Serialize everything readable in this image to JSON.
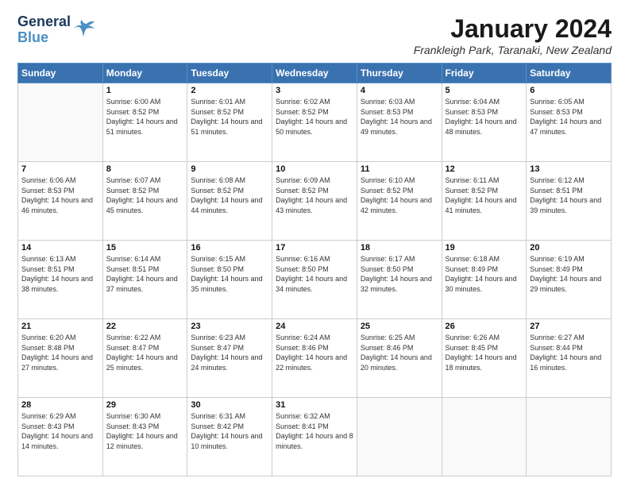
{
  "logo": {
    "line1": "General",
    "line2": "Blue"
  },
  "header": {
    "title": "January 2024",
    "location": "Frankleigh Park, Taranaki, New Zealand"
  },
  "days_of_week": [
    "Sunday",
    "Monday",
    "Tuesday",
    "Wednesday",
    "Thursday",
    "Friday",
    "Saturday"
  ],
  "weeks": [
    [
      {
        "day": "",
        "sunrise": "",
        "sunset": "",
        "daylight": ""
      },
      {
        "day": "1",
        "sunrise": "Sunrise: 6:00 AM",
        "sunset": "Sunset: 8:52 PM",
        "daylight": "Daylight: 14 hours and 51 minutes."
      },
      {
        "day": "2",
        "sunrise": "Sunrise: 6:01 AM",
        "sunset": "Sunset: 8:52 PM",
        "daylight": "Daylight: 14 hours and 51 minutes."
      },
      {
        "day": "3",
        "sunrise": "Sunrise: 6:02 AM",
        "sunset": "Sunset: 8:52 PM",
        "daylight": "Daylight: 14 hours and 50 minutes."
      },
      {
        "day": "4",
        "sunrise": "Sunrise: 6:03 AM",
        "sunset": "Sunset: 8:53 PM",
        "daylight": "Daylight: 14 hours and 49 minutes."
      },
      {
        "day": "5",
        "sunrise": "Sunrise: 6:04 AM",
        "sunset": "Sunset: 8:53 PM",
        "daylight": "Daylight: 14 hours and 48 minutes."
      },
      {
        "day": "6",
        "sunrise": "Sunrise: 6:05 AM",
        "sunset": "Sunset: 8:53 PM",
        "daylight": "Daylight: 14 hours and 47 minutes."
      }
    ],
    [
      {
        "day": "7",
        "sunrise": "Sunrise: 6:06 AM",
        "sunset": "Sunset: 8:53 PM",
        "daylight": "Daylight: 14 hours and 46 minutes."
      },
      {
        "day": "8",
        "sunrise": "Sunrise: 6:07 AM",
        "sunset": "Sunset: 8:52 PM",
        "daylight": "Daylight: 14 hours and 45 minutes."
      },
      {
        "day": "9",
        "sunrise": "Sunrise: 6:08 AM",
        "sunset": "Sunset: 8:52 PM",
        "daylight": "Daylight: 14 hours and 44 minutes."
      },
      {
        "day": "10",
        "sunrise": "Sunrise: 6:09 AM",
        "sunset": "Sunset: 8:52 PM",
        "daylight": "Daylight: 14 hours and 43 minutes."
      },
      {
        "day": "11",
        "sunrise": "Sunrise: 6:10 AM",
        "sunset": "Sunset: 8:52 PM",
        "daylight": "Daylight: 14 hours and 42 minutes."
      },
      {
        "day": "12",
        "sunrise": "Sunrise: 6:11 AM",
        "sunset": "Sunset: 8:52 PM",
        "daylight": "Daylight: 14 hours and 41 minutes."
      },
      {
        "day": "13",
        "sunrise": "Sunrise: 6:12 AM",
        "sunset": "Sunset: 8:51 PM",
        "daylight": "Daylight: 14 hours and 39 minutes."
      }
    ],
    [
      {
        "day": "14",
        "sunrise": "Sunrise: 6:13 AM",
        "sunset": "Sunset: 8:51 PM",
        "daylight": "Daylight: 14 hours and 38 minutes."
      },
      {
        "day": "15",
        "sunrise": "Sunrise: 6:14 AM",
        "sunset": "Sunset: 8:51 PM",
        "daylight": "Daylight: 14 hours and 37 minutes."
      },
      {
        "day": "16",
        "sunrise": "Sunrise: 6:15 AM",
        "sunset": "Sunset: 8:50 PM",
        "daylight": "Daylight: 14 hours and 35 minutes."
      },
      {
        "day": "17",
        "sunrise": "Sunrise: 6:16 AM",
        "sunset": "Sunset: 8:50 PM",
        "daylight": "Daylight: 14 hours and 34 minutes."
      },
      {
        "day": "18",
        "sunrise": "Sunrise: 6:17 AM",
        "sunset": "Sunset: 8:50 PM",
        "daylight": "Daylight: 14 hours and 32 minutes."
      },
      {
        "day": "19",
        "sunrise": "Sunrise: 6:18 AM",
        "sunset": "Sunset: 8:49 PM",
        "daylight": "Daylight: 14 hours and 30 minutes."
      },
      {
        "day": "20",
        "sunrise": "Sunrise: 6:19 AM",
        "sunset": "Sunset: 8:49 PM",
        "daylight": "Daylight: 14 hours and 29 minutes."
      }
    ],
    [
      {
        "day": "21",
        "sunrise": "Sunrise: 6:20 AM",
        "sunset": "Sunset: 8:48 PM",
        "daylight": "Daylight: 14 hours and 27 minutes."
      },
      {
        "day": "22",
        "sunrise": "Sunrise: 6:22 AM",
        "sunset": "Sunset: 8:47 PM",
        "daylight": "Daylight: 14 hours and 25 minutes."
      },
      {
        "day": "23",
        "sunrise": "Sunrise: 6:23 AM",
        "sunset": "Sunset: 8:47 PM",
        "daylight": "Daylight: 14 hours and 24 minutes."
      },
      {
        "day": "24",
        "sunrise": "Sunrise: 6:24 AM",
        "sunset": "Sunset: 8:46 PM",
        "daylight": "Daylight: 14 hours and 22 minutes."
      },
      {
        "day": "25",
        "sunrise": "Sunrise: 6:25 AM",
        "sunset": "Sunset: 8:46 PM",
        "daylight": "Daylight: 14 hours and 20 minutes."
      },
      {
        "day": "26",
        "sunrise": "Sunrise: 6:26 AM",
        "sunset": "Sunset: 8:45 PM",
        "daylight": "Daylight: 14 hours and 18 minutes."
      },
      {
        "day": "27",
        "sunrise": "Sunrise: 6:27 AM",
        "sunset": "Sunset: 8:44 PM",
        "daylight": "Daylight: 14 hours and 16 minutes."
      }
    ],
    [
      {
        "day": "28",
        "sunrise": "Sunrise: 6:29 AM",
        "sunset": "Sunset: 8:43 PM",
        "daylight": "Daylight: 14 hours and 14 minutes."
      },
      {
        "day": "29",
        "sunrise": "Sunrise: 6:30 AM",
        "sunset": "Sunset: 8:43 PM",
        "daylight": "Daylight: 14 hours and 12 minutes."
      },
      {
        "day": "30",
        "sunrise": "Sunrise: 6:31 AM",
        "sunset": "Sunset: 8:42 PM",
        "daylight": "Daylight: 14 hours and 10 minutes."
      },
      {
        "day": "31",
        "sunrise": "Sunrise: 6:32 AM",
        "sunset": "Sunset: 8:41 PM",
        "daylight": "Daylight: 14 hours and 8 minutes."
      },
      {
        "day": "",
        "sunrise": "",
        "sunset": "",
        "daylight": ""
      },
      {
        "day": "",
        "sunrise": "",
        "sunset": "",
        "daylight": ""
      },
      {
        "day": "",
        "sunrise": "",
        "sunset": "",
        "daylight": ""
      }
    ]
  ]
}
